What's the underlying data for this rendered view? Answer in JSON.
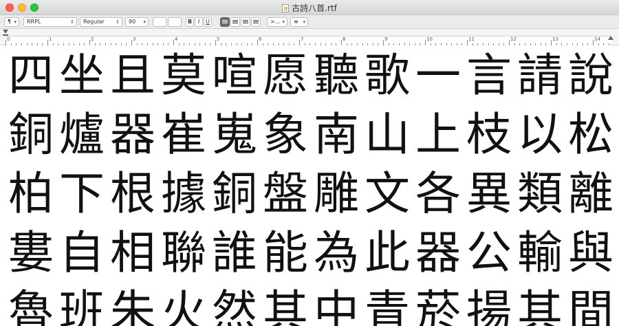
{
  "window": {
    "title": "古詩八首.rtf"
  },
  "toolbar": {
    "paragraph_style": "¶",
    "font_family": "RRPL",
    "typeface": "Regular",
    "font_size": "90",
    "bold_label": "B",
    "italic_label": "I",
    "underline_label": "U",
    "spacing_label": "1.0",
    "list_label": "≡"
  },
  "ruler": {
    "numbers": [
      "0",
      "1",
      "2",
      "3",
      "4",
      "5",
      "6",
      "7",
      "8",
      "9",
      "10",
      "11",
      "12",
      "13",
      "14"
    ]
  },
  "document": {
    "rows": [
      [
        "四",
        "坐",
        "且",
        "莫",
        "喧",
        "愿",
        "聽",
        "歌",
        "一",
        "言",
        "請",
        "說"
      ],
      [
        "銅",
        "爐",
        "器",
        "崔",
        "嵬",
        "象",
        "南",
        "山",
        "上",
        "枝",
        "以",
        "松"
      ],
      [
        "柏",
        "下",
        "根",
        "據",
        "銅",
        "盤",
        "雕",
        "文",
        "各",
        "異",
        "類",
        "離"
      ],
      [
        "婁",
        "自",
        "相",
        "聯",
        "誰",
        "能",
        "為",
        "此",
        "器",
        "公",
        "輸",
        "與"
      ],
      [
        "魯",
        "班",
        "朱",
        "火",
        "然",
        "其",
        "中",
        "青",
        "菸",
        "揚",
        "其",
        "間"
      ]
    ]
  }
}
